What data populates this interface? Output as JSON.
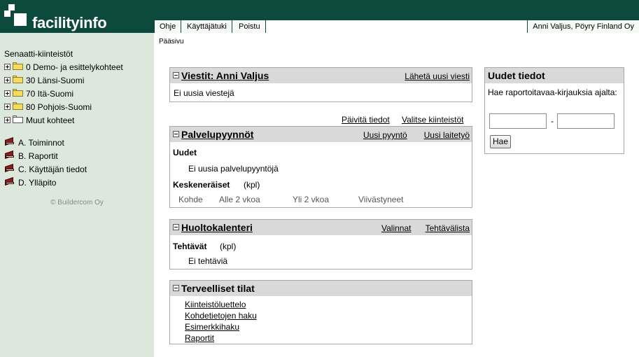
{
  "brand": {
    "name": "facilityinfo"
  },
  "nav": {
    "items": [
      {
        "label": "Ohje"
      },
      {
        "label": "Käyttäjätuki"
      },
      {
        "label": "Poistu"
      }
    ],
    "user": "Anni Valjus, Pöyry Finland Oy"
  },
  "sidebar": {
    "title": "Senaatti-kiinteistöt",
    "folders": [
      {
        "label": "0 Demo- ja esittelykohteet",
        "icon": "folder-icon"
      },
      {
        "label": "30 Länsi-Suomi",
        "icon": "folder-icon"
      },
      {
        "label": "70 Itä-Suomi",
        "icon": "folder-icon"
      },
      {
        "label": "80 Pohjois-Suomi",
        "icon": "folder-icon"
      },
      {
        "label": "Muut kohteet",
        "icon": "folder-empty-icon"
      }
    ],
    "sections": [
      {
        "label": "A. Toiminnot",
        "icon": "book-icon"
      },
      {
        "label": "B. Raportit",
        "icon": "book-icon"
      },
      {
        "label": "C. Käyttäjän tiedot",
        "icon": "book-icon"
      },
      {
        "label": "D. Ylläpito",
        "icon": "book-icon"
      }
    ],
    "copyright": "© Buildercom Oy"
  },
  "breadcrumb": "Pääsivu",
  "messages": {
    "title": "Viestit: Anni Valjus",
    "send_link": "Lähetä uusi viesti",
    "empty": "Ei uusia viestejä"
  },
  "toolbar": {
    "refresh_link": "Päivitä tiedot",
    "select_link": "Valitse kiinteistöt"
  },
  "service_requests": {
    "title": "Palvelupyynnöt",
    "new_request_link": "Uusi pyyntö",
    "new_device_link": "Uusi laitetyö",
    "new_heading": "Uudet",
    "new_empty": "Ei uusia palvelupyyntöjä",
    "in_progress_heading": "Keskeneräiset",
    "in_progress_unit": "(kpl)",
    "columns": [
      "Kohde",
      "Alle 2 vkoa",
      "Yli 2 vkoa",
      "Viivästyneet"
    ]
  },
  "maintenance": {
    "title": "Huoltokalenteri",
    "options_link": "Valinnat",
    "tasklist_link": "Tehtävälista",
    "tasks_heading": "Tehtävät",
    "tasks_unit": "(kpl)",
    "tasks_empty": "Ei tehtäviä"
  },
  "healthy": {
    "title": "Terveelliset tilat",
    "links": [
      "Kiinteistöluettelo",
      "Kohdetietojen haku",
      "Esimerkkihaku",
      "Raportit"
    ]
  },
  "new_info": {
    "title": "Uudet tiedot",
    "description": "Hae raportoitavaa-kirjauksia ajalta:",
    "separator": "-",
    "start_value": "",
    "end_value": "",
    "button": "Hae"
  }
}
